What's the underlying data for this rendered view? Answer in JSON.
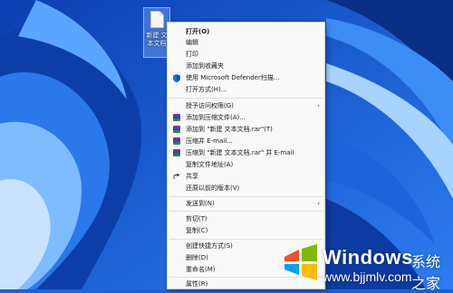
{
  "desktop": {
    "file": {
      "name": "新建 文本文档",
      "icon": "text-document-icon"
    }
  },
  "menu": {
    "items": [
      {
        "label": "打开(O)",
        "bold": true
      },
      {
        "label": "编辑"
      },
      {
        "label": "打印"
      },
      {
        "label": "添加到收藏夹"
      },
      {
        "label": "使用 Microsoft Defender扫描...",
        "icon": "defender-shield-icon"
      },
      {
        "label": "打开方式(H)..."
      },
      {
        "label": "授予访问权限(G)",
        "submenu": true
      },
      {
        "label": "添加到压缩文件(A)...",
        "icon": "winrar-icon"
      },
      {
        "label": "添加到 \"新建 文本文档.rar\"(T)",
        "icon": "winrar-icon"
      },
      {
        "label": "压缩并 E-mail...",
        "icon": "winrar-icon"
      },
      {
        "label": "压缩到 \"新建 文本文档.rar\" 并 E-mail",
        "icon": "winrar-icon"
      },
      {
        "label": "复制文件地址(A)"
      },
      {
        "label": "共享",
        "icon": "share-icon"
      },
      {
        "label": "还原以前的版本(V)"
      },
      {
        "label": "发送到(N)",
        "submenu": true
      },
      {
        "label": "剪切(T)"
      },
      {
        "label": "复制(C)"
      },
      {
        "label": "创建快捷方式(S)"
      },
      {
        "label": "删除(D)"
      },
      {
        "label": "重命名(M)"
      },
      {
        "label": "属性(R)"
      }
    ],
    "submenu_arrow": "›"
  },
  "watermark": {
    "title": "Windows",
    "subtitle": "系统之家",
    "url": "www.bjjmlv.com",
    "logo_icon": "windows-logo-icon",
    "colors": {
      "red": "#f25022",
      "green": "#7fba00",
      "blue": "#00a4ef",
      "yellow": "#ffb900"
    }
  }
}
